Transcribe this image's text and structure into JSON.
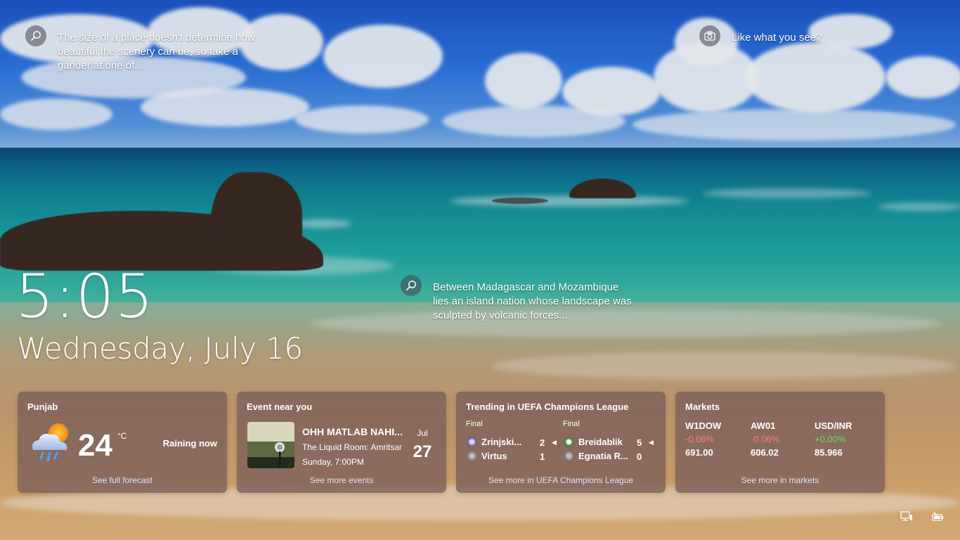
{
  "hints": {
    "left": {
      "icon": "search-icon",
      "text": "The size of a place doesn't determine how beautiful the scenery can be, so take a gander at one of..."
    },
    "right": {
      "icon": "camera-icon",
      "text": "Like what you see?"
    },
    "middle": {
      "icon": "search-icon",
      "text": "Between Madagascar and Mozambique lies an island nation whose landscape was sculpted by volcanic forces..."
    }
  },
  "clock": {
    "time": "5:05",
    "date": "Wednesday, July 16"
  },
  "weather": {
    "title": "Punjab",
    "temp": "24",
    "unit": "°C",
    "condition": "Raining now",
    "icon": "partly-cloudy-rain-icon",
    "link": "See full forecast"
  },
  "event": {
    "title": "Event near you",
    "name": "OHH MATLAB NAHI...",
    "venue": "The Liquid Room: Amritsar",
    "time": "Sunday, 7:00PM",
    "month": "Jul",
    "day": "27",
    "link": "See more events"
  },
  "sports": {
    "title": "Trending in UEFA Champions League",
    "matches": [
      {
        "status": "Final",
        "home": "Zrinjski...",
        "home_score": "2",
        "away": "Virtus",
        "away_score": "1"
      },
      {
        "status": "Final",
        "home": "Breidablik",
        "home_score": "5",
        "away": "Egnatia R...",
        "away_score": "0"
      }
    ],
    "link": "See more in UEFA Champions League"
  },
  "markets": {
    "title": "Markets",
    "items": [
      {
        "name": "W1DOW",
        "change": "-0.06%",
        "value": "691.00",
        "color": "#ff7a8a"
      },
      {
        "name": "AW01",
        "change": "-0.06%",
        "value": "606.02",
        "color": "#ff7a8a"
      },
      {
        "name": "USD/INR",
        "change": "+0.00%",
        "value": "85.966",
        "color": "#5ee06a"
      }
    ],
    "link": "See more in markets"
  },
  "system_tray": {
    "network_icon": "network-icon",
    "battery_icon": "battery-icon"
  }
}
